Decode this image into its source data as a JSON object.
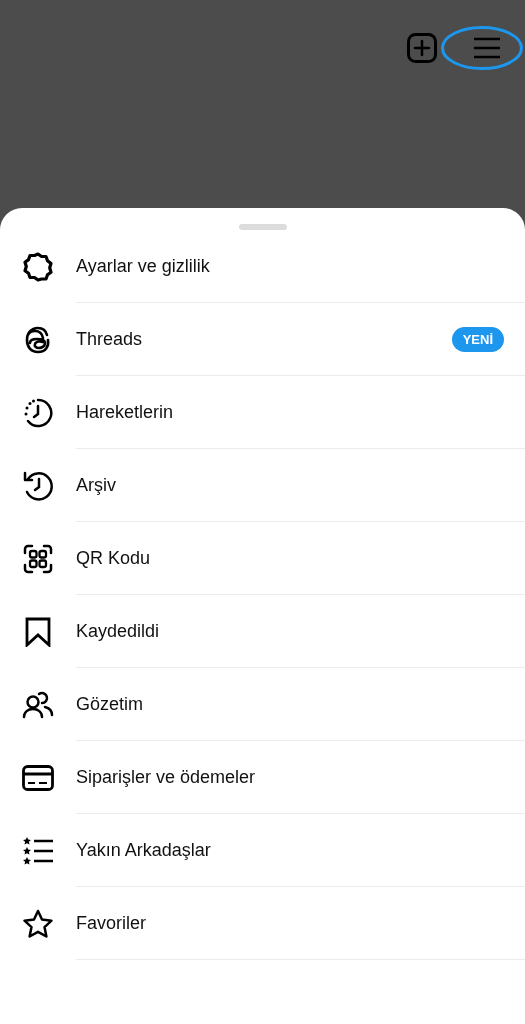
{
  "menu_items": [
    {
      "label": "Ayarlar ve gizlilik"
    },
    {
      "label": "Threads",
      "badge": "YENİ"
    },
    {
      "label": "Hareketlerin"
    },
    {
      "label": "Arşiv"
    },
    {
      "label": "QR Kodu"
    },
    {
      "label": "Kaydedildi"
    },
    {
      "label": "Gözetim"
    },
    {
      "label": "Siparişler ve ödemeler"
    },
    {
      "label": "Yakın Arkadaşlar"
    },
    {
      "label": "Favoriler"
    }
  ]
}
